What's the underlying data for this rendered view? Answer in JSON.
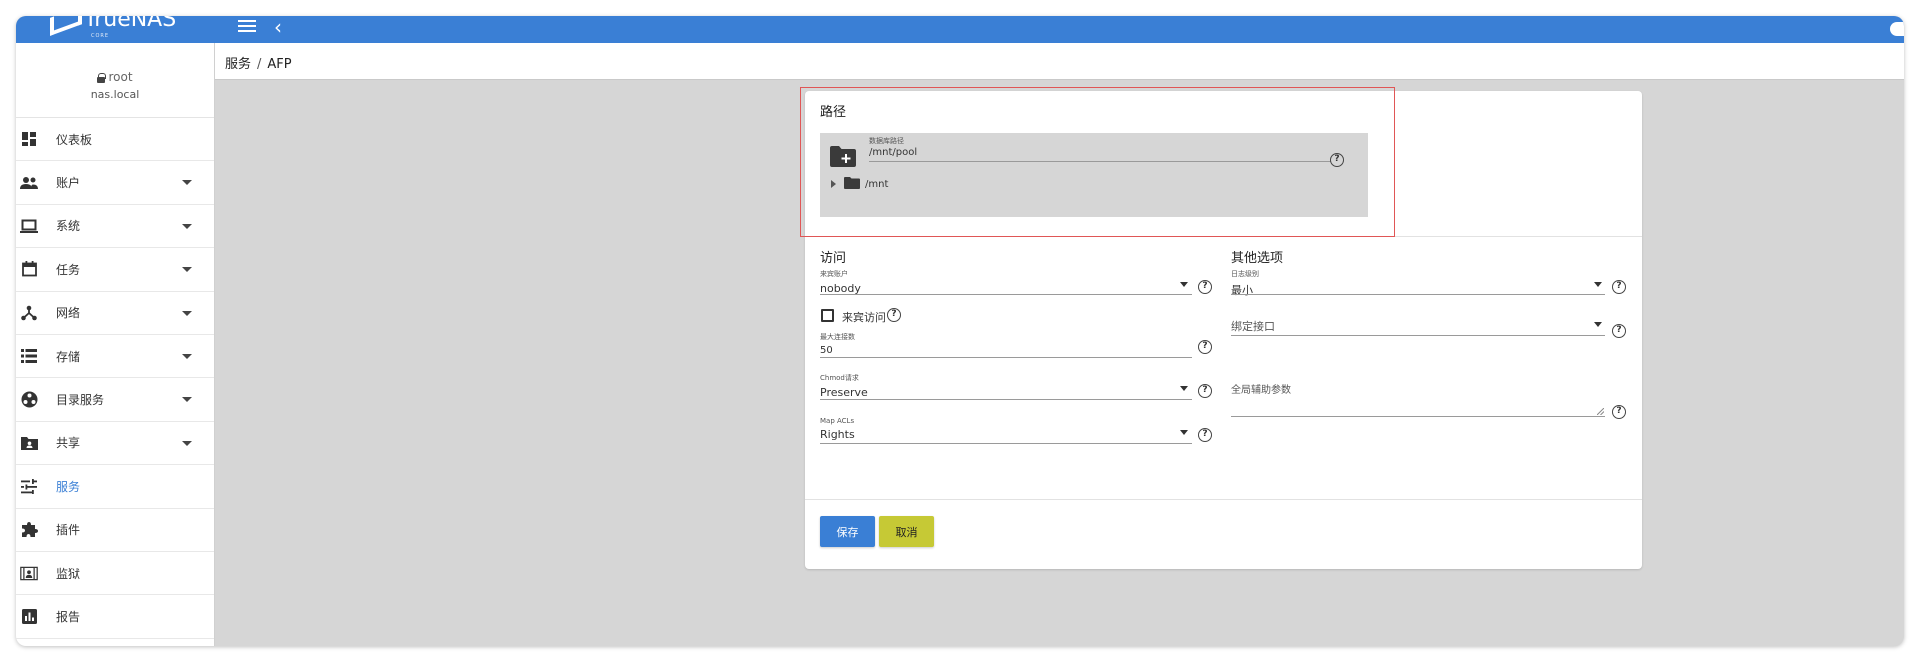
{
  "app": {
    "logo_text": "TrueNAS",
    "logo_sub": "CORE"
  },
  "user": {
    "name": "root",
    "host": "nas.local"
  },
  "sidebar": {
    "items": [
      {
        "label": "仪表板",
        "icon": "dashboard-icon"
      },
      {
        "label": "账户",
        "icon": "people-icon"
      },
      {
        "label": "系统",
        "icon": "laptop-icon"
      },
      {
        "label": "任务",
        "icon": "calendar-icon"
      },
      {
        "label": "网络",
        "icon": "network-icon"
      },
      {
        "label": "存储",
        "icon": "storage-icon"
      },
      {
        "label": "目录服务",
        "icon": "directory-icon"
      },
      {
        "label": "共享",
        "icon": "shared-folder-icon"
      },
      {
        "label": "服务",
        "icon": "tune-icon"
      },
      {
        "label": "插件",
        "icon": "puzzle-icon"
      },
      {
        "label": "监狱",
        "icon": "jail-icon"
      },
      {
        "label": "报告",
        "icon": "report-icon"
      }
    ]
  },
  "breadcrumb": {
    "parent": "服务",
    "separator": "/",
    "current": "AFP"
  },
  "form": {
    "path_section": {
      "title": "路径",
      "label": "数据库路径",
      "value": "/mnt/pool",
      "tree_root": "/mnt"
    },
    "access": {
      "title": "访问",
      "guest_account": {
        "label": "来宾账户",
        "value": "nobody"
      },
      "guest_access": {
        "label": "来宾访问",
        "checked": false
      },
      "max_connections": {
        "label": "最大连接数",
        "value": "50"
      },
      "chmod": {
        "label": "Chmod请求",
        "value": "Preserve"
      },
      "map_acls": {
        "label": "Map ACLs",
        "value": "Rights"
      }
    },
    "other": {
      "title": "其他选项",
      "log_level": {
        "label": "日志级别",
        "value": "最小"
      },
      "bind_interface": {
        "placeholder": "绑定接口"
      },
      "aux_params": {
        "placeholder": "全局辅助参数"
      }
    },
    "buttons": {
      "save": "保存",
      "cancel": "取消"
    }
  },
  "colors": {
    "topbar": "#3a7fd5",
    "save": "#3a7fd5",
    "cancel": "#c6c935",
    "highlight": "#e05656"
  }
}
